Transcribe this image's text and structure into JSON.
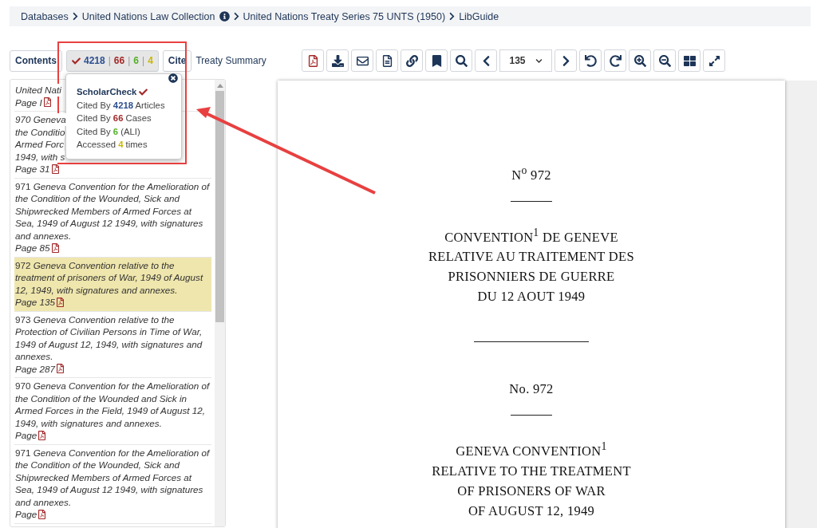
{
  "breadcrumb": [
    {
      "label": "Databases",
      "info": false
    },
    {
      "label": "United Nations Law Collection",
      "info": true
    },
    {
      "label": "United Nations Treaty Series 75 UNTS (1950)",
      "info": false
    },
    {
      "label": "LibGuide",
      "info": false
    }
  ],
  "tabs": {
    "contents": "Contents",
    "separator": "|",
    "counts": [
      {
        "value": "4218",
        "color": "#2b4f91"
      },
      {
        "value": "66",
        "color": "#a32a2a"
      },
      {
        "value": "6",
        "color": "#55b02b"
      },
      {
        "value": "4",
        "color": "#c9b800"
      }
    ],
    "cite": "Cite",
    "summary": "Treaty Summary"
  },
  "popup": {
    "title": "ScholarCheck",
    "lines": [
      {
        "before": "Cited By",
        "count": "4218",
        "after": "Articles",
        "color": "#2b4f91"
      },
      {
        "before": "Cited By",
        "count": "66",
        "after": "Cases",
        "color": "#a32a2a"
      },
      {
        "before": "Cited By",
        "count": "6",
        "after": "(ALI)",
        "color": "#55b02b"
      },
      {
        "before": "Accessed",
        "count": "4",
        "after": "times",
        "color": "#c9b800"
      }
    ]
  },
  "contents": [
    {
      "kind": "covered",
      "lines": [
        "United Nati"
      ],
      "page": "Page I",
      "selected": false
    },
    {
      "kind": "covered",
      "lines": [
        "970 Geneva",
        "the Conditio",
        "Armed Forc",
        "1949, with s"
      ],
      "page": "Page 31",
      "selected": false
    },
    {
      "kind": "entry",
      "number": "971",
      "title": "Geneva Convention for the Amelioration of the Condition of the Wounded, Sick and Shipwrecked Members of Armed Forces at Sea, 1949 of August 12 1949, with signatures and annexes.",
      "page": "Page 85",
      "selected": false
    },
    {
      "kind": "entry",
      "number": "972",
      "title": "Geneva Convention relative to the treatment of prisoners of War, 1949 of August 12, 1949, with signatures and annexes.",
      "page": "Page 135",
      "selected": true
    },
    {
      "kind": "entry",
      "number": "973",
      "title": "Geneva Convention relative to the Protection of Civilian Persons in Time of War, 1949 of August 12, 1949, with signatures and annexes.",
      "page": "Page 287",
      "selected": false
    },
    {
      "kind": "entry",
      "number": "970",
      "title": "Geneva Convention for the Amelioration of the Condition of the Wounded and Sick in Armed Forces in the Field, 1949 of August 12, 1949, with signatures and annexes.",
      "page": "Page",
      "selected": false
    },
    {
      "kind": "entry",
      "number": "971",
      "title": "Geneva Convention for the Amelioration of the Condition of the Wounded, Sick and Shipwrecked Members of Armed Forces at Sea, 1949 of August 12 1949, with signatures and annexes.",
      "page": "Page",
      "selected": false
    }
  ],
  "page_select": "135",
  "document": [
    {
      "kind": "text",
      "lines": [
        "N$^{o}$ 972"
      ]
    },
    {
      "kind": "short_rule"
    },
    {
      "kind": "text",
      "lines": [
        "CONVENTION$^{1}$ DE GENEVE",
        "RELATIVE AU TRAITEMENT DES",
        "PRISONNIERS DE GUERRE",
        "DU 12 AOUT 1949"
      ]
    },
    {
      "kind": "long_rule"
    },
    {
      "kind": "text",
      "lines": [
        "No. 972"
      ]
    },
    {
      "kind": "short_rule"
    },
    {
      "kind": "text",
      "lines": [
        "GENEVA CONVENTION$^{1}$",
        "RELATIVE TO THE TREATMENT",
        "OF PRISONERS OF WAR",
        "OF AUGUST 12, 1949"
      ]
    }
  ]
}
